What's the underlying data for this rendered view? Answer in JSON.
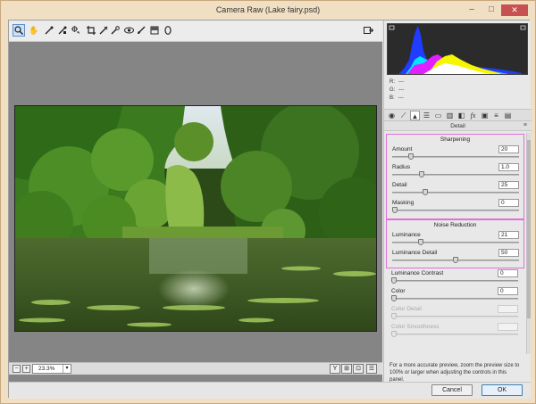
{
  "window": {
    "title": "Camera Raw (Lake fairy.psd)",
    "minimize": "–",
    "maximize": "□",
    "close": "✕"
  },
  "toolbar": {
    "tools": [
      "zoom-icon",
      "hand-icon",
      "white-balance-icon",
      "color-sampler-icon",
      "targeted-adjustment-icon",
      "crop-icon",
      "straighten-icon",
      "spot-removal-icon",
      "red-eye-icon",
      "adjustment-brush-icon",
      "graduated-filter-icon",
      "radial-filter-icon"
    ],
    "right_tool": "open-preferences-icon"
  },
  "preview": {
    "zoom_out": "−",
    "zoom_in": "+",
    "zoom_value": "23.3%",
    "view_buttons": [
      "Y",
      "⊞",
      "⊡",
      "☰"
    ]
  },
  "readout": {
    "r_label": "R:",
    "r_value": "---",
    "g_label": "G:",
    "g_value": "---",
    "b_label": "B:",
    "b_value": "---"
  },
  "panel": {
    "title": "Detail",
    "tabs": [
      "basic-icon",
      "tone-curve-icon",
      "detail-icon",
      "hsl-icon",
      "split-toning-icon",
      "lens-icon",
      "effects-icon",
      "fx-icon",
      "camera-icon",
      "presets-icon",
      "snapshots-icon"
    ],
    "sharpening": {
      "title": "Sharpening",
      "amount_label": "Amount",
      "amount_value": "20",
      "amount_fraction": 0.13,
      "radius_label": "Radius",
      "radius_value": "1.0",
      "radius_fraction": 0.22,
      "detail_label": "Detail",
      "detail_value": "25",
      "detail_fraction": 0.25,
      "masking_label": "Masking",
      "masking_value": "0",
      "masking_fraction": 0.0
    },
    "noise": {
      "title": "Noise Reduction",
      "luminance_label": "Luminance",
      "luminance_value": "21",
      "luminance_fraction": 0.21,
      "luminance_detail_label": "Luminance Detail",
      "luminance_detail_value": "50",
      "luminance_detail_fraction": 0.5,
      "luminance_contrast_label": "Luminance Contrast",
      "luminance_contrast_value": "0",
      "luminance_contrast_fraction": 0.0,
      "color_label": "Color",
      "color_value": "0",
      "color_fraction": 0.0,
      "color_detail_label": "Color Detail",
      "color_detail_value": "",
      "color_smoothness_label": "Color Smoothness",
      "color_smoothness_value": ""
    },
    "hint": "For a more accurate preview, zoom the preview size to 100% or larger when adjusting the controls in this panel."
  },
  "footer": {
    "cancel": "Cancel",
    "ok": "OK"
  },
  "colors": {
    "highlight_border": "#e26ed8",
    "preview_bg": "#858585",
    "panel_bg": "#e8e8e8"
  }
}
